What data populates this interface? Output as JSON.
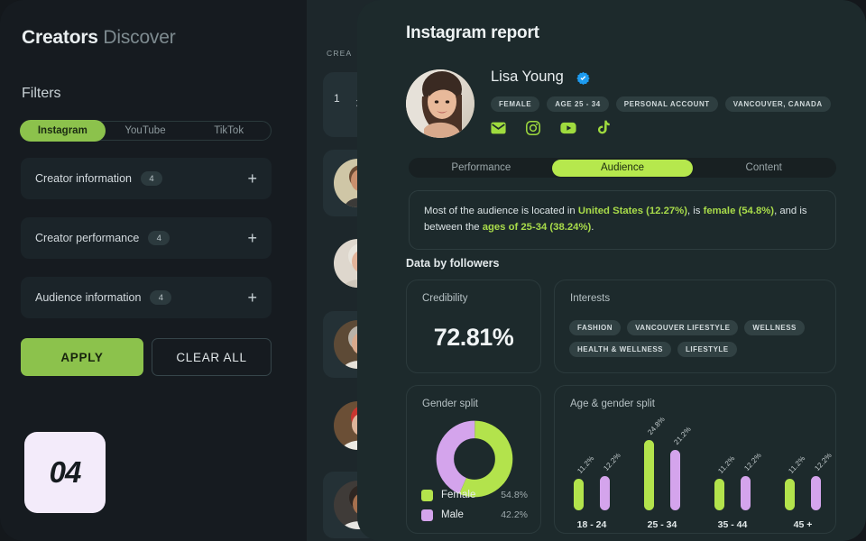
{
  "filters_panel": {
    "title_strong": "Creators",
    "title_muted": "Discover",
    "filters_heading": "Filters",
    "platform_tabs": [
      {
        "label": "Instagram",
        "active": true
      },
      {
        "label": "YouTube",
        "active": false
      },
      {
        "label": "TikTok",
        "active": false
      }
    ],
    "filter_rows": [
      {
        "label": "Creator information",
        "count": "4",
        "plus": "+"
      },
      {
        "label": "Creator performance",
        "count": "4",
        "plus": "+"
      },
      {
        "label": "Audience information",
        "count": "4",
        "plus": "+"
      }
    ],
    "apply_label": "APPLY",
    "clear_all_label": "CLEAR ALL",
    "step_badge": "04"
  },
  "creators_list": {
    "title": "CREA",
    "result_count": "1",
    "close_icon": "×"
  },
  "report": {
    "title": "Instagram report",
    "profile": {
      "name": "Lisa Young",
      "verified": true,
      "tags": [
        "FEMALE",
        "AGE 25 - 34",
        "PERSONAL ACCOUNT",
        "VANCOUVER, CANADA"
      ],
      "social_icons": [
        "email-icon",
        "instagram-icon",
        "youtube-icon",
        "tiktok-icon"
      ]
    },
    "tabs": [
      {
        "label": "Performance",
        "active": false
      },
      {
        "label": "Audience",
        "active": true
      },
      {
        "label": "Content",
        "active": false
      }
    ],
    "summary": {
      "part1": "Most of the audience is located in ",
      "hl1": "United States (12.27%)",
      "part2": ", is ",
      "hl2": "female (54.8%)",
      "part3": ", and is between the ",
      "hl3": "ages of 25-34 (38.24%)",
      "part4": "."
    },
    "section_heading": "Data by followers",
    "credibility": {
      "title": "Credibility",
      "value": "72.81%"
    },
    "interests": {
      "title": "Interests",
      "tags": [
        "FASHION",
        "VANCOUVER LIFESTYLE",
        "WELLNESS",
        "HEALTH & WELLNESS",
        "LIFESTYLE"
      ]
    },
    "gender_split": {
      "title": "Gender split"
    },
    "age_gender_split": {
      "title": "Age & gender split"
    }
  },
  "colors": {
    "accent_green": "#b6e84d",
    "olive_green": "#8cc24c",
    "female": "#b3e34c",
    "male": "#d4a4ec",
    "panel_bg": "#1d2a2c",
    "sidebar_bg": "#161b20",
    "page_bg": "#14181c",
    "badge_bg": "#f3ebfa",
    "verified_blue": "#1d9bf0"
  },
  "chart_data": [
    {
      "type": "pie",
      "title": "Gender split",
      "labels": [
        "Female",
        "Male"
      ],
      "values": [
        54.8,
        42.2
      ],
      "display_values": [
        "54.8%",
        "42.2%"
      ],
      "colors": [
        "#b3e34c",
        "#d4a4ec"
      ],
      "donut": true,
      "legend": "bottom"
    },
    {
      "type": "bar",
      "title": "Age & gender split",
      "categories": [
        "18 - 24",
        "25 - 34",
        "35 - 44",
        "45 +"
      ],
      "series": [
        {
          "name": "Female",
          "color": "#b3e34c",
          "values": [
            11.2,
            24.8,
            11.2,
            11.2
          ],
          "labels": [
            "11.2%",
            "24.8%",
            "11.2%",
            "11.2%"
          ]
        },
        {
          "name": "Male",
          "color": "#d4a4ec",
          "values": [
            12.2,
            21.2,
            12.2,
            12.2
          ],
          "labels": [
            "12.2%",
            "21.2%",
            "12.2%",
            "12.2%"
          ]
        }
      ],
      "xlabel": "",
      "ylabel": "",
      "ylim": [
        0,
        26
      ],
      "grid": false,
      "legend": "none",
      "data_labels": true
    }
  ]
}
